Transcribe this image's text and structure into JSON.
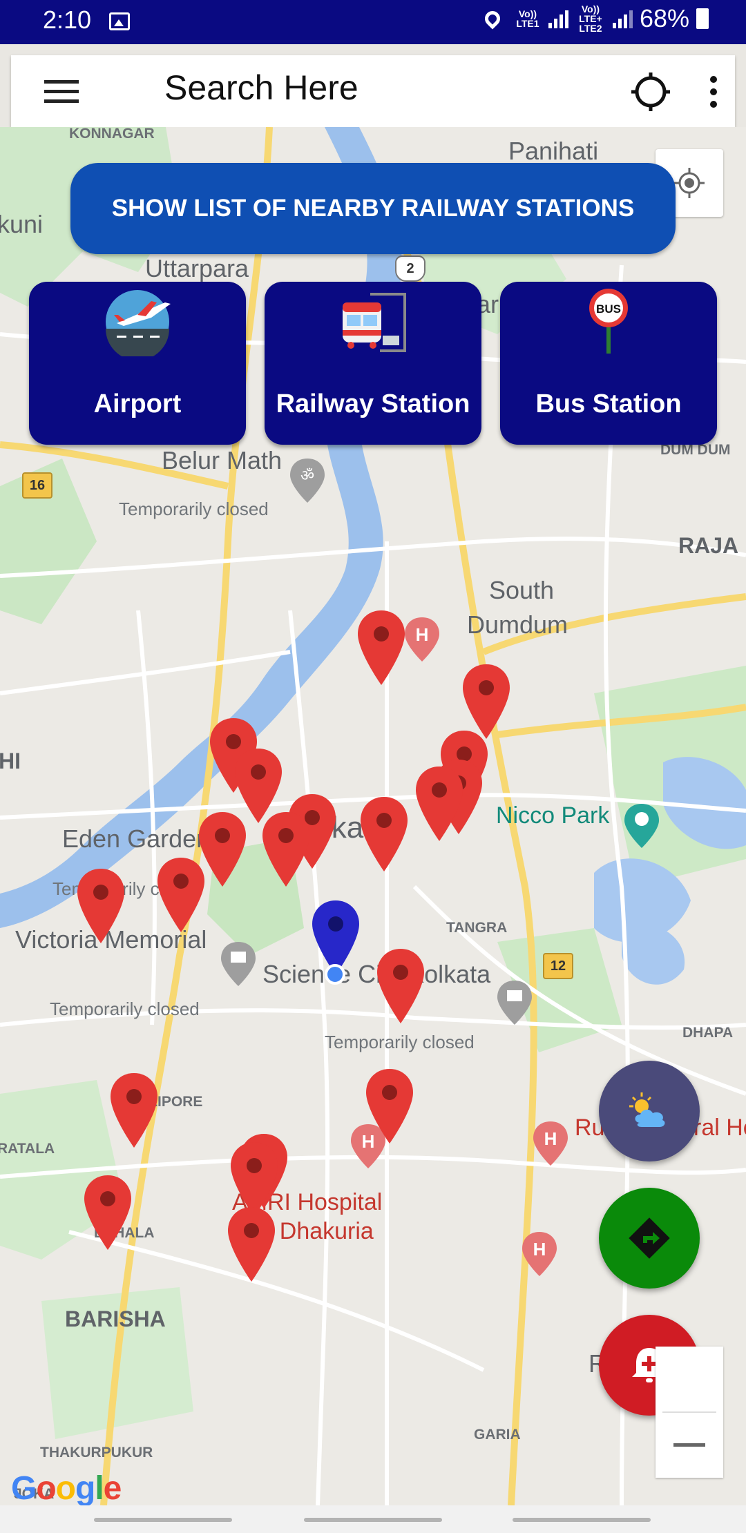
{
  "status_bar": {
    "time": "2:10",
    "net1": "Vo)) LTE1",
    "net2": "Vo)) LTE+ LTE2",
    "battery": "68%"
  },
  "search_bar": {
    "placeholder": "Search Here"
  },
  "nearby_button": {
    "label": "SHOW LIST OF NEARBY RAILWAY STATIONS"
  },
  "categories": [
    {
      "label": "Airport",
      "icon": "airplane-icon"
    },
    {
      "label": "Railway Station",
      "icon": "train-icon"
    },
    {
      "label": "Bus Station",
      "icon": "bus-stop-icon"
    }
  ],
  "map_labels": {
    "konnagar": "KONNAGAR",
    "panihati": "Panihati",
    "kuni": "kuni",
    "uttarpara": "Uttarpara",
    "ar": "ar",
    "belur_math": "Belur Math",
    "temp_closed_1": "Temporarily closed",
    "dum_dum": "DUM DUM",
    "raja": "RAJA",
    "south_dumdum_1": "South",
    "south_dumdum_2": "Dumdum",
    "hi": "HI",
    "nicco_park": "Nicco Park",
    "eden_gardens": "Eden Garden",
    "kolkata_center": "lkat",
    "temp_closed_2": "Temporarily closed",
    "victoria_memorial": "Victoria Memorial",
    "tangra": "TANGRA",
    "science_city": "Science City Kolkata",
    "temp_closed_3": "Temporarily closed",
    "temp_closed_4": "Temporarily closed",
    "dhapa": "DHAPA",
    "alipore": "ALIPORE",
    "ratala": "RATALA",
    "ruby_hospital": "Ruby General Ho",
    "amri_1": "AMRI Hospital",
    "amri_2": "- Dhakuria",
    "behala": "BEHALA",
    "barisha": "BARISHA",
    "r_label": "R",
    "thakurpukur": "THAKURPUKUR",
    "garia": "GARIA",
    "joka": "JOKA",
    "highway_2": "2",
    "highway_16": "16",
    "highway_12": "12"
  },
  "google_logo": "Google",
  "fabs": [
    {
      "name": "weather",
      "icon": "weather-icon",
      "color": "#4a4a7a"
    },
    {
      "name": "directions",
      "icon": "directions-icon",
      "color": "#0a8a0a"
    },
    {
      "name": "emergency",
      "icon": "alarm-plus-icon",
      "color": "#d01c24"
    }
  ],
  "colors": {
    "status_bar": "#0a0a82",
    "card": "#0a0a82",
    "nearby_button": "#0f4fb3",
    "marker_red": "#e53935",
    "marker_blue": "#2727c9"
  }
}
